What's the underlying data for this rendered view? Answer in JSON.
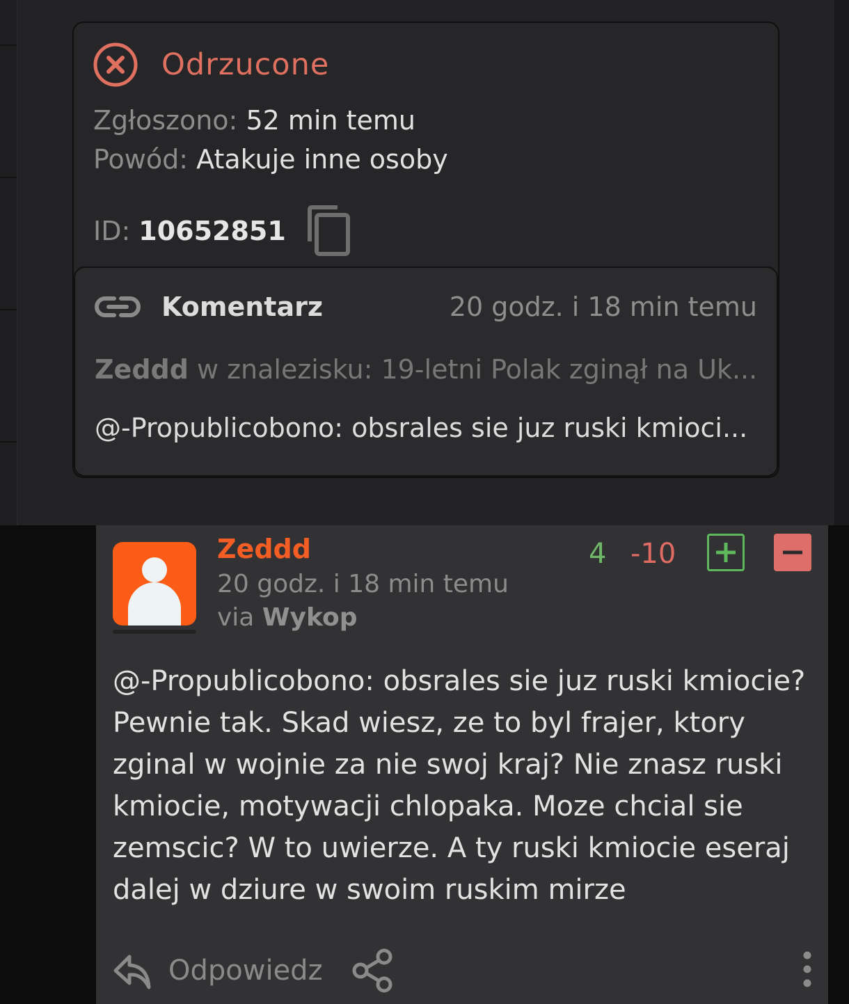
{
  "report": {
    "status": "Odrzucone",
    "reported_label": "Zgłoszono:",
    "reported_value": "52 min temu",
    "reason_label": "Powód:",
    "reason_value": "Atakuje inne osoby",
    "id_label": "ID:",
    "id_value": "10652851",
    "status_color": "#e0705f"
  },
  "subject": {
    "type": "Komentarz",
    "time": "20 godz. i 18 min temu",
    "author": "Zeddd",
    "source": "w znalezisku: 19-letni Polak zginął na Uk...",
    "excerpt": "@-Propublicobono: obsrales sie juz ruski kmioci..."
  },
  "comment": {
    "author": "Zeddd",
    "time": "20 godz. i 18 min temu",
    "via_prefix": "via",
    "via_source": "Wykop",
    "plus_count": "4",
    "minus_count": "-10",
    "body": "@-Propublicobono: obsrales sie juz ruski kmiocie? Pewnie tak. Skad wiesz, ze to byl frajer, ktory zginal w wojnie za nie swoj kraj? Nie znasz ruski kmiocie, motywacji chlopaka. Moze chcial sie zemscic? W to uwierze. A ty ruski kmiocie eseraj dalej w dziure w swoim ruskim mirze",
    "reply_label": "Odpowiedz",
    "avatar_color": "#fb5d17",
    "author_color": "#f45e24"
  },
  "icons": {
    "status": "close-circle-icon",
    "copy": "copy-icon",
    "link": "link-icon",
    "plus": "plus-box-icon",
    "minus": "minus-box-icon",
    "reply": "reply-icon",
    "share": "share-icon",
    "more": "more-vertical-icon"
  }
}
